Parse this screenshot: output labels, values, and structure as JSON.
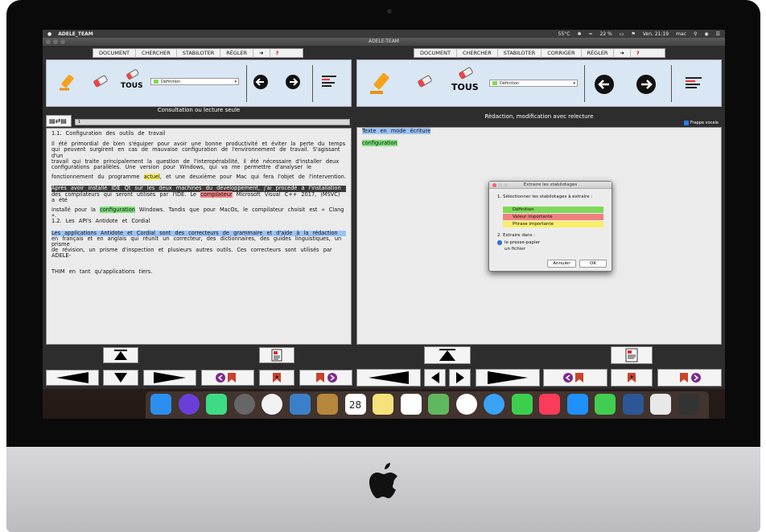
{
  "menubar": {
    "app": "ADELE_TEAM",
    "temp": "55°C",
    "battery": "22 %",
    "clock": "Ven. 21:19",
    "user": "mac"
  },
  "window": {
    "title": "ADELE-TEAM"
  },
  "left_menu": [
    "DOCUMENT",
    "CHERCHER",
    "STABILOTER",
    "RÉGLER",
    "?"
  ],
  "right_menu": [
    "DOCUMENT",
    "CHERCHER",
    "STABILOTER",
    "CORRIGER",
    "RÉGLER",
    "?"
  ],
  "left_toolbar": {
    "tous_label": "TOUS",
    "select_value": "Définition"
  },
  "right_toolbar": {
    "tous_label": "TOUS",
    "select_value": "Définition"
  },
  "left_mode_label": "Consultation ou lecture seule",
  "right_mode_label": "Rèdaction, modification avec relecture",
  "frappe_vocale": "Frappe vocale",
  "page_field": "1",
  "doc_left": {
    "l1": "1.1.  Configuration  des  outils  de  travail",
    "p1": "Il  été  primordial  de  bien  s'équiper  pour  avoir  une  bonne  productivité  et  éviter  la  perte du temps",
    "p1b": "qui  peuvent  surgirent  en  cas  de  mauvaise  configuration  de  l'environnement  de  travail.  S'agissant  d'un",
    "p1c": "travail  qui  traite  principalement  la  question  de  l'interopérabilité,  il  été  nécessaire  d'installer  deux",
    "p1d": "configurations  parallèles.  Une  version  pour  Windows,  qui  va  me  permettre  d'analyser  le",
    "p2a": "fonctionnement  du  programme  ",
    "p2hl": "actuel",
    "p2b": ",  et  une  deuxième  pour  Mac  qui  fera  l'objet  de  l'intervention.",
    "p3": "Après  avoir  installé  IDE  Qt  sur  les  deux  machines  du  développement,  j'ai  procédé  à  l'installation",
    "p4a": "des  compilateurs  qui  seront  utilisés  par  l'IDE.  Le  ",
    "p4hl": "compilateur",
    "p4b": "  Microsoft  Visual  C++  2017,  (MSVC)  a  été",
    "p5a": "installé  pour  la  ",
    "p5hl": "configuration",
    "p5b": "  Windows.  Tandis  que  pour  MacOs,  le  compilateur  choisit  est  «  Clang  ».",
    "l2": "1.2.  Les  API's  Antidote  et  Cordial",
    "p6": "Les  applications  Antidote  et  Cordial  sont  des  correcteurs  de  grammaire  et  d'aide  à  la  rédaction",
    "p7": "en  français  et  en  anglais  qui  réunit  un  correcteur,  des  dictionnaires,  des  guides  linguistiques,  un  prisme",
    "p7b": "de  révision,  un  prisme  d'inspection  et  plusieurs  autres  outils.  Ces  correcteurs  sont  utilisés  par  ADELE-",
    "p8": "THIM  en  tant  qu'applications  tiers."
  },
  "doc_right": {
    "l1": "Texte  en  mode  écriture",
    "l2": "configuration"
  },
  "dialog": {
    "title": "Extraire les stabilotages",
    "step1": "1. Sélectionner les stabilotages à extraire :",
    "opt1": "Définition",
    "opt2": "Valeur importante",
    "opt3": "Phrase importante",
    "step2": "2. Extraire dans :",
    "radio1": "le presse-papier",
    "radio2": "un fichier",
    "cancel": "Annuler",
    "ok": "OK"
  },
  "colors": {
    "definition": "#7ed957",
    "valeur": "#f08080",
    "phrase": "#f7ee6a",
    "selection": "#9cc3f5"
  },
  "dock_icons": [
    "finder-icon",
    "siri-icon",
    "android-studio-icon",
    "launchpad-icon",
    "chrome-icon",
    "preview-icon",
    "notes-book-icon",
    "calendar-icon",
    "notes-icon",
    "reminders-icon",
    "maps-icon",
    "photos-icon",
    "messages-icon",
    "facetime-icon",
    "music-icon",
    "appstore-icon",
    "qt-creator-icon",
    "word-icon",
    "textedit-icon",
    "trash-icon"
  ],
  "calendar_day": "28"
}
